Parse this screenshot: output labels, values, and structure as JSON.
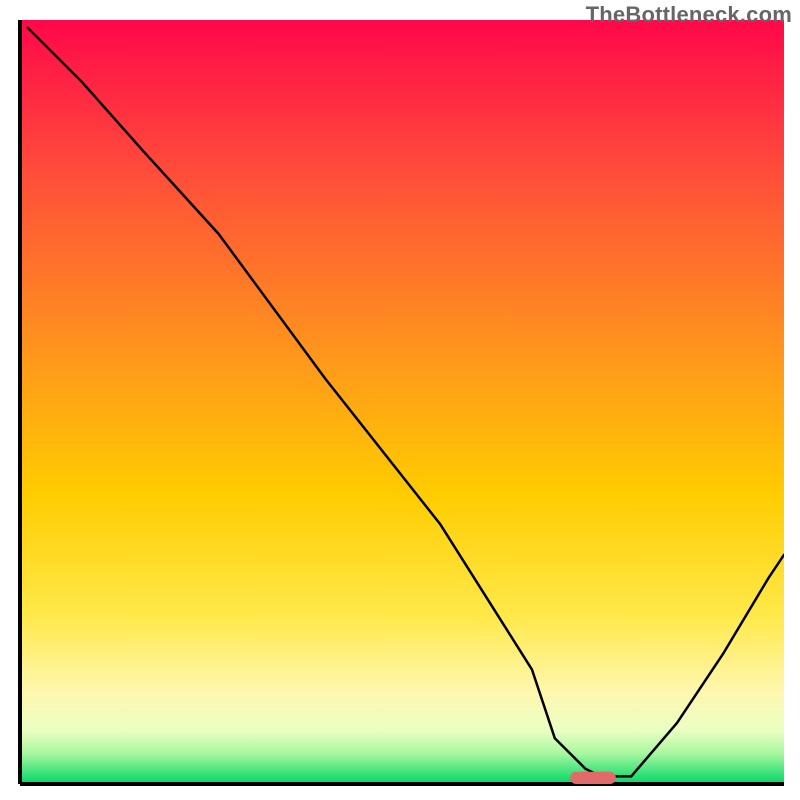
{
  "watermark": "TheBottleneck.com",
  "chart_data": {
    "type": "line",
    "title": "",
    "xlabel": "",
    "ylabel": "",
    "xlim": [
      0,
      100
    ],
    "ylim": [
      0,
      100
    ],
    "grid": false,
    "legend": false,
    "background": {
      "gradient_top": "#ff084a",
      "gradient_mid_upper": "#ff8a00",
      "gradient_mid_lower": "#ffe000",
      "gradient_pale": "#ffffc0",
      "gradient_bottom": "#00e676"
    },
    "series": [
      {
        "name": "curve",
        "type": "line",
        "color": "#000000",
        "x": [
          1,
          8,
          16,
          26,
          40,
          55,
          67,
          70,
          74,
          76,
          80,
          86,
          92,
          98,
          100
        ],
        "y": [
          99,
          92,
          83,
          72,
          53,
          34,
          15,
          6,
          2,
          1,
          1,
          8,
          17,
          27,
          30
        ]
      },
      {
        "name": "marker",
        "type": "marker",
        "shape": "capsule",
        "color": "#e26a6a",
        "x_center": 75,
        "y_center": 0.8,
        "width": 6,
        "height": 1.6
      }
    ]
  }
}
